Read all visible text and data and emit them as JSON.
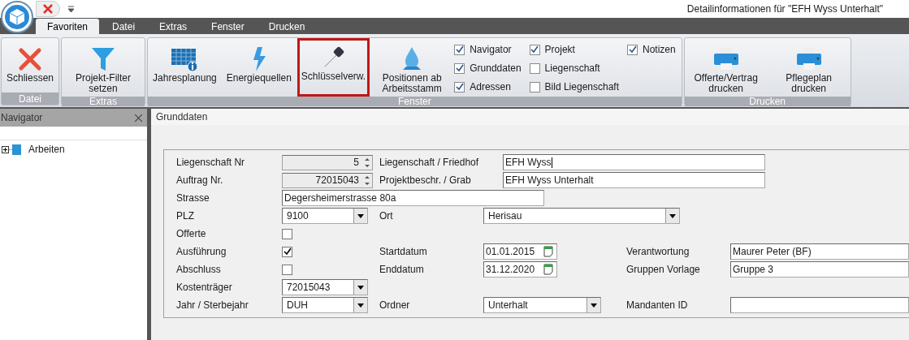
{
  "window": {
    "title": "Detailinformationen für \"EFH Wyss Unterhalt\""
  },
  "tabs": [
    {
      "label": "Favoriten",
      "selected": true
    },
    {
      "label": "Datei",
      "selected": false
    },
    {
      "label": "Extras",
      "selected": false
    },
    {
      "label": "Fenster",
      "selected": false
    },
    {
      "label": "Drucken",
      "selected": false
    }
  ],
  "ribbon_groups": [
    {
      "label": "Datei",
      "buttons": [
        {
          "kind": "close",
          "label": "Schliessen",
          "highlighted": false
        }
      ]
    },
    {
      "label": "Extras",
      "buttons": [
        {
          "kind": "filter",
          "label": "Projekt-Filter setzen",
          "highlighted": false
        }
      ]
    },
    {
      "label": "Fenster",
      "buttons": [
        {
          "kind": "calendar",
          "label": "Jahresplanung",
          "highlighted": false
        },
        {
          "kind": "bolt",
          "label": "Energiequellen",
          "highlighted": false
        },
        {
          "kind": "key",
          "label": "Schlüsselverw.",
          "highlighted": true
        },
        {
          "kind": "drop",
          "label": "Positionen ab Arbeitsstamm",
          "highlighted": false
        }
      ],
      "checkboxes": [
        {
          "label": "Navigator",
          "checked": true
        },
        {
          "label": "Grunddaten",
          "checked": true
        },
        {
          "label": "Adressen",
          "checked": true
        },
        {
          "label": "Projekt",
          "checked": true
        },
        {
          "label": "Liegenschaft",
          "checked": false
        },
        {
          "label": "Bild Liegenschaft",
          "checked": false
        },
        {
          "label": "Notizen",
          "checked": true
        }
      ]
    },
    {
      "label": "Drucken",
      "buttons": [
        {
          "kind": "printer",
          "label": "Offerte/Vertrag drucken",
          "highlighted": false
        },
        {
          "kind": "printer",
          "label": "Pflegeplan drucken",
          "highlighted": false
        }
      ]
    }
  ],
  "navigator": {
    "title": "Navigator",
    "tree": [
      {
        "label": "Arbeiten",
        "expanded": false
      }
    ]
  },
  "panel": {
    "title": "Grunddaten"
  },
  "form_rows": [
    [
      {
        "kind": "label",
        "text": "Liegenschaft Nr"
      },
      {
        "kind": "spinner",
        "value": "5"
      },
      {
        "kind": "label",
        "text": "Liegenschaft / Friedhof"
      },
      {
        "kind": "text",
        "value": "EFH Wyss",
        "focused": true
      }
    ],
    [
      {
        "kind": "label",
        "text": "Auftrag Nr."
      },
      {
        "kind": "spinner",
        "value": "72015043"
      },
      {
        "kind": "label",
        "text": "Projektbeschr. / Grab"
      },
      {
        "kind": "text",
        "value": "EFH Wyss Unterhalt",
        "focused": false
      }
    ],
    [
      {
        "kind": "label",
        "text": "Strasse"
      },
      {
        "kind": "text",
        "value": "Degersheimerstrasse 80a",
        "focused": false
      }
    ],
    [
      {
        "kind": "label",
        "text": "PLZ"
      },
      {
        "kind": "dropdown",
        "value": "9100"
      },
      {
        "kind": "label",
        "text": "Ort"
      },
      {
        "kind": "dropdown",
        "value": "Herisau"
      }
    ],
    [
      {
        "kind": "label",
        "text": "Offerte"
      },
      {
        "kind": "checkbox",
        "checked": false
      }
    ],
    [
      {
        "kind": "label",
        "text": "Ausführung"
      },
      {
        "kind": "checkbox",
        "checked": true
      },
      {
        "kind": "label",
        "text": "Startdatum"
      },
      {
        "kind": "date",
        "value": "01.01.2015"
      },
      {
        "kind": "label",
        "text": "Verantwortung"
      },
      {
        "kind": "text",
        "value": "Maurer Peter (BF)",
        "focused": false
      }
    ],
    [
      {
        "kind": "label",
        "text": "Abschluss"
      },
      {
        "kind": "checkbox",
        "checked": false
      },
      {
        "kind": "label",
        "text": "Enddatum"
      },
      {
        "kind": "date",
        "value": "31.12.2020"
      },
      {
        "kind": "label",
        "text": "Gruppen Vorlage"
      },
      {
        "kind": "text",
        "value": "Gruppe 3",
        "focused": false
      }
    ],
    [
      {
        "kind": "label",
        "text": "Kostenträger"
      },
      {
        "kind": "dropdown",
        "value": "72015043"
      }
    ],
    [
      {
        "kind": "label",
        "text": "Jahr / Sterbejahr"
      },
      {
        "kind": "dropdown",
        "value": "DUH"
      },
      {
        "kind": "label",
        "text": "Ordner"
      },
      {
        "kind": "dropdown",
        "value": "Unterhalt"
      },
      {
        "kind": "label",
        "text": "Mandanten ID"
      },
      {
        "kind": "text"
      }
    ]
  ]
}
